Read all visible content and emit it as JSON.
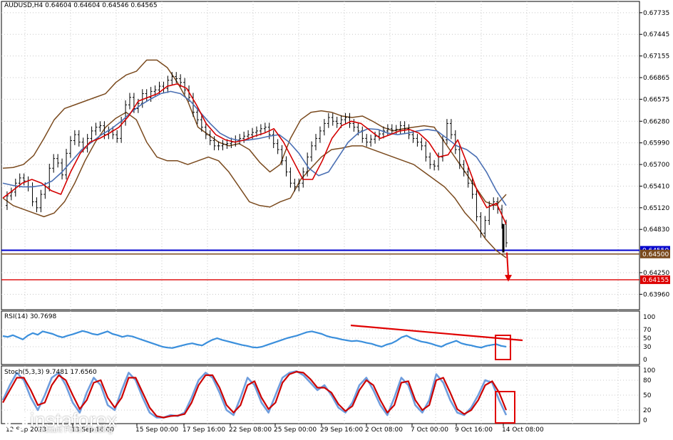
{
  "header": {
    "symbol": "AUDUSD,H4",
    "ohlc": "0.64604 0.64604 0.64546 0.64565"
  },
  "rsi_label": "RSI(14) 30.7698",
  "stoch_label": "Stoch(5,3,3) 9.7481 17.6560",
  "watermark": {
    "brand": "instaforex",
    "tagline": "Instant Forex Trading"
  },
  "colors": {
    "price_bars": "#000000",
    "bollinger": "#7a4a1e",
    "ma_fast": "#d40000",
    "ma_slow": "#4a6fb3",
    "rsi_line": "#3b8fdc",
    "stoch_main": "#6f9ddd",
    "stoch_signal": "#cc0000",
    "support_blue": "#0000cc",
    "level_brown": "#7a4a1e",
    "level_red": "#dd0000",
    "annotation": "#e00000"
  },
  "chart_data": [
    {
      "type": "line",
      "title": "AUDUSD,H4",
      "y_ticks": [
        "0.67735",
        "0.67445",
        "0.67155",
        "0.66865",
        "0.66575",
        "0.66280",
        "0.65990",
        "0.65700",
        "0.65410",
        "0.65120",
        "0.64830",
        "0.64250",
        "0.63960"
      ],
      "ylim": [
        0.6382,
        0.6781
      ],
      "x_labels": [
        "12 Sep 2023",
        "13 Sep 16:00",
        "15 Sep 00:00",
        "17 Sep 16:00",
        "22 Sep 08:00",
        "25 Sep 00:00",
        "29 Sep 16:00",
        "2 Oct 08:00",
        "7 Oct 00:00",
        "9 Oct 16:00",
        "14 Oct 08:00"
      ],
      "price_labels": [
        {
          "name": "blue support",
          "value": 0.6455,
          "text": "0.64550"
        },
        {
          "name": "brown level",
          "value": 0.645,
          "text": "0.64500"
        },
        {
          "name": "red target",
          "value": 0.64155,
          "text": "0.64155"
        }
      ],
      "series": [
        {
          "role": "price",
          "values": [
            0.6515,
            0.6528,
            0.6533,
            0.6545,
            0.6552,
            0.6548,
            0.654,
            0.652,
            0.6512,
            0.653,
            0.654,
            0.6565,
            0.6578,
            0.6572,
            0.6556,
            0.6585,
            0.6602,
            0.661,
            0.66,
            0.6592,
            0.6605,
            0.6615,
            0.662,
            0.6622,
            0.661,
            0.6615,
            0.661,
            0.6605,
            0.6628,
            0.665,
            0.666,
            0.6645,
            0.6652,
            0.6665,
            0.666,
            0.6668,
            0.667,
            0.6675,
            0.6672,
            0.6683,
            0.6688,
            0.6685,
            0.668,
            0.667,
            0.666,
            0.664,
            0.663,
            0.662,
            0.661,
            0.6602,
            0.6595,
            0.6595,
            0.6597,
            0.6598,
            0.66,
            0.6603,
            0.6605,
            0.6608,
            0.661,
            0.6613,
            0.6615,
            0.6618,
            0.662,
            0.661,
            0.6598,
            0.659,
            0.6575,
            0.656,
            0.6545,
            0.654,
            0.6545,
            0.656,
            0.658,
            0.6595,
            0.6605,
            0.6615,
            0.6625,
            0.6633,
            0.6628,
            0.6625,
            0.663,
            0.6633,
            0.6625,
            0.662,
            0.6615,
            0.6605,
            0.66,
            0.6604,
            0.6608,
            0.6611,
            0.6615,
            0.6618,
            0.6616,
            0.6617,
            0.6622,
            0.6618,
            0.661,
            0.6605,
            0.66,
            0.6595,
            0.658,
            0.657,
            0.6568,
            0.658,
            0.6603,
            0.6625,
            0.661,
            0.659,
            0.657,
            0.656,
            0.6545,
            0.653,
            0.65,
            0.6478,
            0.6495,
            0.6515,
            0.652,
            0.651,
            0.649,
            0.6465
          ]
        },
        {
          "role": "bollinger-upper",
          "values": [
            0.6565,
            0.6566,
            0.657,
            0.6582,
            0.6605,
            0.663,
            0.6645,
            0.665,
            0.6655,
            0.666,
            0.6665,
            0.668,
            0.669,
            0.6695,
            0.671,
            0.671,
            0.67,
            0.668,
            0.6655,
            0.662,
            0.661,
            0.66,
            0.6595,
            0.6598,
            0.659,
            0.6573,
            0.656,
            0.657,
            0.6605,
            0.663,
            0.664,
            0.6642,
            0.664,
            0.6635,
            0.6633,
            0.6635,
            0.6628,
            0.662,
            0.6615,
            0.6618,
            0.662,
            0.6622,
            0.662,
            0.66,
            0.658,
            0.656,
            0.654,
            0.652,
            0.6515,
            0.653
          ]
        },
        {
          "role": "bollinger-lower",
          "values": [
            0.6525,
            0.6515,
            0.651,
            0.6505,
            0.65,
            0.6505,
            0.652,
            0.6545,
            0.6575,
            0.66,
            0.662,
            0.6632,
            0.664,
            0.663,
            0.66,
            0.658,
            0.6575,
            0.6575,
            0.657,
            0.6575,
            0.658,
            0.6575,
            0.656,
            0.654,
            0.652,
            0.6515,
            0.6513,
            0.652,
            0.6525,
            0.655,
            0.6565,
            0.658,
            0.659,
            0.6592,
            0.6595,
            0.6595,
            0.659,
            0.6585,
            0.658,
            0.6575,
            0.657,
            0.656,
            0.655,
            0.654,
            0.6525,
            0.6505,
            0.649,
            0.647,
            0.6455,
            0.6445
          ]
        },
        {
          "role": "ma-fast",
          "values": [
            0.6525,
            0.6535,
            0.6545,
            0.655,
            0.6545,
            0.6535,
            0.653,
            0.656,
            0.6585,
            0.66,
            0.6605,
            0.6612,
            0.662,
            0.6635,
            0.6655,
            0.666,
            0.6665,
            0.6675,
            0.6678,
            0.6672,
            0.665,
            0.6625,
            0.661,
            0.6603,
            0.66,
            0.6603,
            0.6608,
            0.6612,
            0.6618,
            0.66,
            0.6575,
            0.655,
            0.655,
            0.6575,
            0.6605,
            0.6622,
            0.6628,
            0.6625,
            0.6615,
            0.6605,
            0.661,
            0.6615,
            0.6617,
            0.6612,
            0.66,
            0.658,
            0.6583,
            0.6603,
            0.657,
            0.6535,
            0.6512,
            0.6518,
            0.649
          ]
        },
        {
          "role": "ma-slow",
          "values": [
            0.6545,
            0.6542,
            0.654,
            0.654,
            0.6542,
            0.6548,
            0.656,
            0.6575,
            0.659,
            0.66,
            0.661,
            0.6618,
            0.6628,
            0.664,
            0.665,
            0.6658,
            0.6665,
            0.6668,
            0.6665,
            0.6655,
            0.664,
            0.6625,
            0.6612,
            0.6605,
            0.6602,
            0.6603,
            0.6605,
            0.6608,
            0.661,
            0.66,
            0.6585,
            0.6565,
            0.6555,
            0.656,
            0.658,
            0.66,
            0.6612,
            0.6618,
            0.6617,
            0.6612,
            0.661,
            0.6612,
            0.6615,
            0.6617,
            0.6615,
            0.6605,
            0.6595,
            0.659,
            0.658,
            0.656,
            0.6535,
            0.6515
          ]
        }
      ]
    },
    {
      "type": "line",
      "title": "RSI(14) 30.7698",
      "ylim": [
        0,
        100
      ],
      "y_ticks": [
        "100",
        "70",
        "50",
        "30",
        "0"
      ],
      "series": [
        {
          "role": "rsi",
          "values": [
            55,
            53,
            57,
            52,
            47,
            56,
            62,
            58,
            66,
            63,
            60,
            55,
            52,
            56,
            59,
            63,
            67,
            64,
            60,
            58,
            62,
            66,
            60,
            57,
            53,
            56,
            54,
            50,
            46,
            42,
            38,
            34,
            30,
            28,
            27,
            30,
            33,
            36,
            38,
            35,
            33,
            40,
            46,
            50,
            46,
            43,
            40,
            37,
            34,
            32,
            29,
            28,
            30,
            34,
            38,
            42,
            46,
            50,
            53,
            56,
            60,
            64,
            66,
            63,
            60,
            55,
            52,
            50,
            47,
            45,
            43,
            44,
            42,
            39,
            37,
            33,
            30,
            35,
            38,
            44,
            52,
            56,
            50,
            46,
            42,
            40,
            37,
            33,
            30,
            36,
            40,
            44,
            38,
            35,
            33,
            30,
            28,
            32,
            34,
            36,
            32,
            30
          ]
        }
      ]
    },
    {
      "type": "line",
      "title": "Stoch(5,3,3) 9.7481 17.6560",
      "ylim": [
        0,
        100
      ],
      "y_ticks": [
        "100",
        "80",
        "50",
        "20",
        "0"
      ],
      "series": [
        {
          "role": "stoch-main",
          "values": [
            40,
            70,
            95,
            80,
            45,
            20,
            50,
            85,
            95,
            70,
            35,
            15,
            55,
            85,
            70,
            30,
            20,
            60,
            95,
            80,
            45,
            15,
            5,
            5,
            10,
            8,
            15,
            45,
            80,
            95,
            85,
            55,
            20,
            10,
            45,
            85,
            70,
            35,
            15,
            50,
            85,
            95,
            98,
            90,
            75,
            60,
            70,
            50,
            25,
            15,
            35,
            70,
            85,
            60,
            30,
            10,
            45,
            85,
            70,
            30,
            15,
            40,
            92,
            75,
            40,
            15,
            10,
            25,
            50,
            80,
            75,
            40,
            10
          ]
        },
        {
          "role": "stoch-signal",
          "values": [
            35,
            60,
            85,
            85,
            60,
            30,
            35,
            70,
            90,
            80,
            50,
            22,
            40,
            75,
            80,
            45,
            25,
            45,
            85,
            85,
            55,
            25,
            8,
            5,
            8,
            9,
            12,
            35,
            70,
            90,
            90,
            65,
            30,
            15,
            30,
            70,
            78,
            45,
            22,
            35,
            75,
            92,
            97,
            95,
            82,
            65,
            65,
            55,
            32,
            18,
            28,
            60,
            80,
            70,
            40,
            15,
            30,
            75,
            78,
            40,
            20,
            30,
            80,
            85,
            55,
            22,
            12,
            20,
            40,
            70,
            78,
            55,
            20
          ]
        }
      ]
    }
  ]
}
